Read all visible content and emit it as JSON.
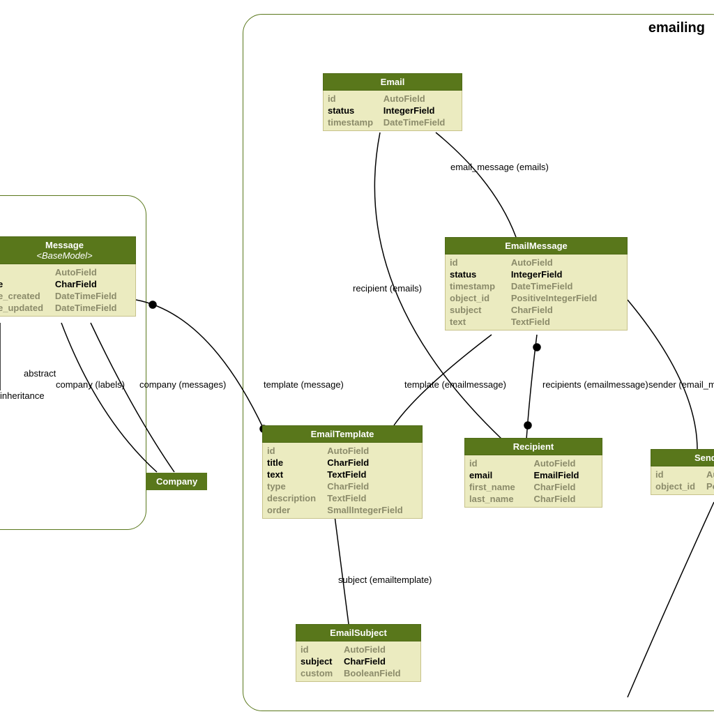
{
  "packages": {
    "messages": {
      "title": ""
    },
    "emailing": {
      "title": "emailing"
    }
  },
  "entities": {
    "message": {
      "title": "Message",
      "subtitle": "<BaseModel>",
      "fields": [
        {
          "name": "",
          "type": "AutoField",
          "req": false
        },
        {
          "name": "e",
          "type": "CharField",
          "req": true
        },
        {
          "name": "e_created",
          "type": "DateTimeField",
          "req": false
        },
        {
          "name": "e_updated",
          "type": "DateTimeField",
          "req": false
        }
      ]
    },
    "company": {
      "title": "Company"
    },
    "email": {
      "title": "Email",
      "fields": [
        {
          "name": "id",
          "type": "AutoField",
          "req": false
        },
        {
          "name": "status",
          "type": "IntegerField",
          "req": true
        },
        {
          "name": "timestamp",
          "type": "DateTimeField",
          "req": false
        }
      ]
    },
    "emailMessage": {
      "title": "EmailMessage",
      "fields": [
        {
          "name": "id",
          "type": "AutoField",
          "req": false
        },
        {
          "name": "status",
          "type": "IntegerField",
          "req": true
        },
        {
          "name": "timestamp",
          "type": "DateTimeField",
          "req": false
        },
        {
          "name": "object_id",
          "type": "PositiveIntegerField",
          "req": false
        },
        {
          "name": "subject",
          "type": "CharField",
          "req": false
        },
        {
          "name": "text",
          "type": "TextField",
          "req": false
        }
      ]
    },
    "emailTemplate": {
      "title": "EmailTemplate",
      "fields": [
        {
          "name": "id",
          "type": "AutoField",
          "req": false
        },
        {
          "name": "title",
          "type": "CharField",
          "req": true
        },
        {
          "name": "text",
          "type": "TextField",
          "req": true
        },
        {
          "name": "type",
          "type": "CharField",
          "req": false
        },
        {
          "name": "description",
          "type": "TextField",
          "req": false
        },
        {
          "name": "order",
          "type": "SmallIntegerField",
          "req": false
        }
      ]
    },
    "recipient": {
      "title": "Recipient",
      "fields": [
        {
          "name": "id",
          "type": "AutoField",
          "req": false
        },
        {
          "name": "email",
          "type": "EmailField",
          "req": true
        },
        {
          "name": "first_name",
          "type": "CharField",
          "req": false
        },
        {
          "name": "last_name",
          "type": "CharField",
          "req": false
        }
      ]
    },
    "sender": {
      "title": "Sender",
      "fields": [
        {
          "name": "id",
          "type": "AutoField",
          "req": false
        },
        {
          "name": "object_id",
          "type": "PositiveInt",
          "req": false
        }
      ]
    },
    "emailSubject": {
      "title": "EmailSubject",
      "fields": [
        {
          "name": "id",
          "type": "AutoField",
          "req": false
        },
        {
          "name": "subject",
          "type": "CharField",
          "req": true
        },
        {
          "name": "custom",
          "type": "BooleanField",
          "req": false
        }
      ]
    }
  },
  "edgeLabels": {
    "abstract": "abstract",
    "inheritance": "inheritance",
    "companyLabels": "company (labels)",
    "companyMessages": "company (messages)",
    "templateMessage": "template (message)",
    "emailMessageEmails": "email_message (emails)",
    "recipientEmails": "recipient (emails)",
    "templateEmailmessage": "template (emailmessage)",
    "recipientsEmailmessage": "recipients (emailmessage)",
    "senderEmailMessage": "sender (email_message)",
    "subjectEmailtemplate": "subject (emailtemplate)"
  }
}
